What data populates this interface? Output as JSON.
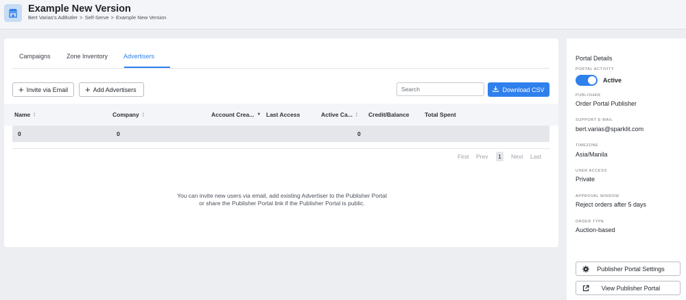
{
  "header": {
    "title": "Example New Version",
    "breadcrumb": [
      "Bert Varias's AdButler",
      "Self-Serve",
      "Example New Version"
    ],
    "logo_icon": "store-icon"
  },
  "tabs": [
    {
      "label": "Campaigns",
      "active": false
    },
    {
      "label": "Zone Inventory",
      "active": false
    },
    {
      "label": "Advertisers",
      "active": true
    }
  ],
  "toolbar": {
    "invite_label": "Invite via Email",
    "add_label": "Add Advertisers",
    "search_placeholder": "Search",
    "download_label": "Download CSV"
  },
  "table": {
    "columns": [
      "Name",
      "Company",
      "Account Crea...",
      "Last Access",
      "Active Ca...",
      "Credit/Balance",
      "Total Spent"
    ],
    "row": {
      "name": "0",
      "company": "0",
      "active": "0"
    }
  },
  "pagination": {
    "first": "First",
    "prev": "Prev",
    "current": "1",
    "next": "Next",
    "last": "Last"
  },
  "empty_message": {
    "line1": "You can invite new users via email, add existing Advertiser to the Publisher Portal",
    "line2": "or share the Publisher Portal link if the Publisher Portal is public."
  },
  "sidebar": {
    "title": "Portal Details",
    "portal_activity": {
      "label": "PORTAL ACTIVITY",
      "value": "Active",
      "enabled": true
    },
    "publisher": {
      "label": "PUBLISHER",
      "value": "Order Portal Publisher"
    },
    "support_email": {
      "label": "SUPPORT E-MAIL",
      "value": "bert.varias@sparklit.com"
    },
    "timezone": {
      "label": "TIMEZONE",
      "value": "Asia/Manila"
    },
    "user_access": {
      "label": "USER ACCESS",
      "value": "Private"
    },
    "approval_window": {
      "label": "APPROVAL WINDOW",
      "value": "Reject orders after 5 days"
    },
    "order_type": {
      "label": "ORDER TYPE",
      "value": "Auction-based"
    },
    "settings_button": "Publisher Portal Settings",
    "view_button": "View Publisher Portal"
  },
  "colors": {
    "accent": "#2f80ed",
    "background": "#edeef2"
  }
}
